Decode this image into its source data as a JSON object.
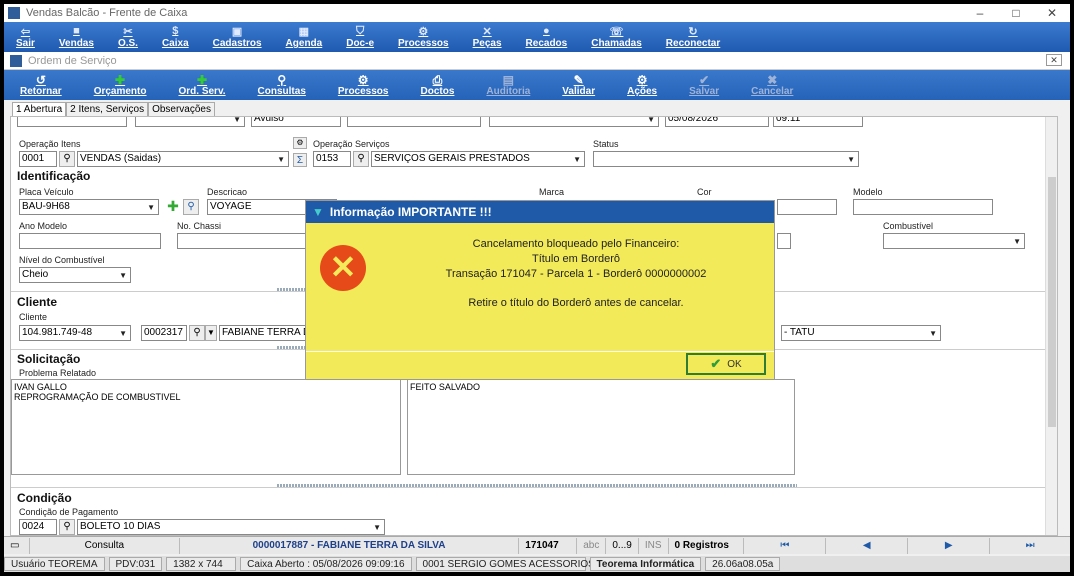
{
  "window": {
    "title": "Vendas Balcão - Frente de Caixa",
    "controls": {
      "minimize": "–",
      "maximize": "□",
      "close": "✕"
    }
  },
  "mainmenu": [
    {
      "label": "Sair",
      "icon": "exit-icon"
    },
    {
      "label": "Vendas",
      "icon": "sales-icon"
    },
    {
      "label": "O.S.",
      "icon": "tools-icon"
    },
    {
      "label": "Caixa",
      "icon": "cashier-icon"
    },
    {
      "label": "Cadastros",
      "icon": "register-icon"
    },
    {
      "label": "Agenda",
      "icon": "calendar-icon"
    },
    {
      "label": "Doc-e",
      "icon": "shield-icon"
    },
    {
      "label": "Processos",
      "icon": "process-icon"
    },
    {
      "label": "Peças",
      "icon": "parts-icon"
    },
    {
      "label": "Recados",
      "icon": "message-icon"
    },
    {
      "label": "Chamadas",
      "icon": "call-icon"
    },
    {
      "label": "Reconectar",
      "icon": "reconnect-icon"
    }
  ],
  "child": {
    "title": "Ordem de Serviço",
    "close": "✕"
  },
  "toolbar": [
    {
      "label": "Retornar"
    },
    {
      "label": "Orçamento"
    },
    {
      "label": "Ord. Serv."
    },
    {
      "label": "Consultas"
    },
    {
      "label": "Processos"
    },
    {
      "label": "Doctos"
    },
    {
      "label": "Auditoria"
    },
    {
      "label": "Validar"
    },
    {
      "label": "Ações"
    },
    {
      "label": "Salvar"
    },
    {
      "label": "Cancelar"
    }
  ],
  "tabs": [
    "1 Abertura",
    "2 Itens, Serviços",
    "Observações"
  ],
  "top_row": {
    "avulso": "Avulso",
    "date": "05/08/2026",
    "time": "09:11"
  },
  "operacao_itens": {
    "label": "Operação Itens",
    "code": "0001",
    "desc": "VENDAS (Saidas)"
  },
  "operacao_servicos": {
    "label": "Operação Serviços",
    "code": "0153",
    "desc": "SERVIÇOS GERAIS PRESTADOS"
  },
  "status": {
    "label": "Status",
    "value": ""
  },
  "identificacao": {
    "section": "Identificação",
    "placa_label": "Placa Veículo",
    "placa": "BAU-9H68",
    "descricao_label": "Descricao",
    "descricao": "VOYAGE",
    "marca_label": "Marca",
    "cor_label": "Cor",
    "modelo_label": "Modelo",
    "ano_label": "Ano Modelo",
    "chassi_label": "No. Chassi",
    "combustivel_label": "Combustível",
    "nivel_label": "Nível do Combustível",
    "nivel": "Cheio"
  },
  "cliente": {
    "section": "Cliente",
    "label": "Cliente",
    "cpf": "104.981.749-48",
    "code": "0002317",
    "name": "FABIANE TERRA DA",
    "cidade": "- TATU"
  },
  "solicitacao": {
    "section": "Solicitação",
    "problema_label": "Problema Relatado",
    "problema_line1": "IVAN GALLO",
    "problema_line2": "REPROGRAMAÇÃO DE COMBUSTIVEL",
    "servico": "FEITO SALVADO"
  },
  "condicao": {
    "section": "Condição",
    "label": "Condição de Pagamento",
    "code": "0024",
    "desc": "BOLETO 10 DIAS"
  },
  "statusbar": {
    "consulta": "Consulta",
    "os": "0000017887 - FABIANE TERRA DA SILVA",
    "num": "171047",
    "abc": "abc",
    "range": "0...9",
    "ins": "INS",
    "registros": "0 Registros"
  },
  "bottombar": {
    "usuario": "Usuário TEOREMA",
    "pdv": "PDV:031",
    "res": "1382 x 744",
    "caixa": "Caixa Aberto : 05/08/2026 09:09:16",
    "empresa": "0001 SERGIO GOMES ACESSORIOS",
    "teorema": "Teorema Informática",
    "versao": "26.06a08.05a"
  },
  "dialog": {
    "title": "Informação IMPORTANTE !!!",
    "line1": "Cancelamento bloqueado pelo Financeiro:",
    "line2": "Título em Borderô",
    "line3": "Transação 171047 - Parcela 1 - Borderô 0000000002",
    "line4": "Retire o título do Borderô antes de cancelar.",
    "ok": "OK"
  },
  "colors": {
    "toolbar": "#1f5ab0",
    "dialog_bg": "#f2ea58",
    "dialog_title": "#1e5aa8",
    "error": "#e64a19"
  }
}
